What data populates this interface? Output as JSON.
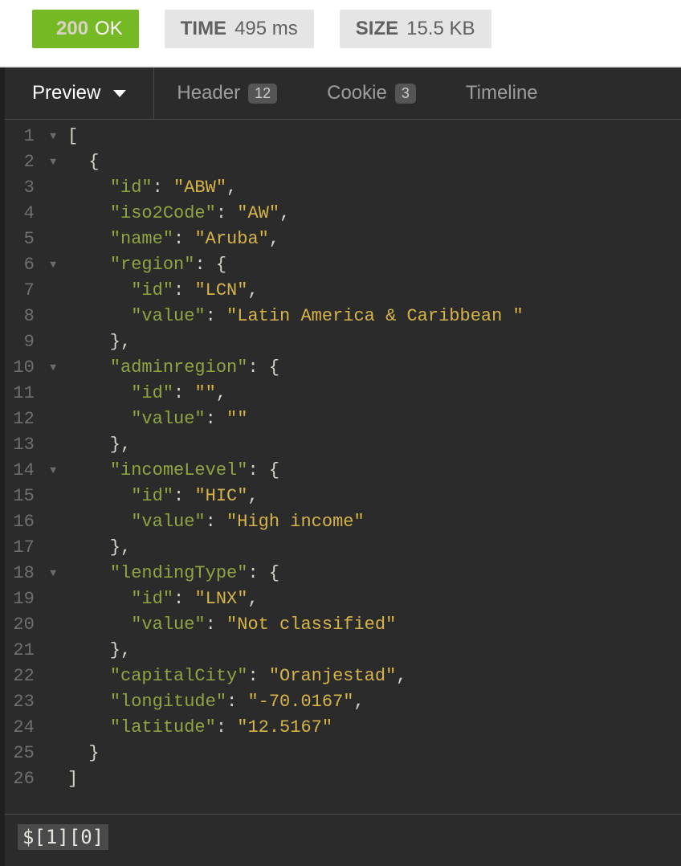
{
  "status": {
    "code": "200",
    "text": "OK"
  },
  "time": {
    "label": "TIME",
    "value": "495 ms"
  },
  "size": {
    "label": "SIZE",
    "value": "15.5 KB"
  },
  "tabs": {
    "preview": {
      "label": "Preview"
    },
    "header": {
      "label": "Header",
      "badge": "12"
    },
    "cookie": {
      "label": "Cookie",
      "badge": "3"
    },
    "timeline": {
      "label": "Timeline"
    }
  },
  "code_lines": [
    {
      "n": 1,
      "fold": true,
      "tokens": [
        [
          "punc",
          "["
        ]
      ]
    },
    {
      "n": 2,
      "fold": true,
      "tokens": [
        [
          "punc",
          "  {"
        ]
      ]
    },
    {
      "n": 3,
      "fold": false,
      "tokens": [
        [
          "punc",
          "    "
        ],
        [
          "key",
          "\"id\""
        ],
        [
          "punc",
          ": "
        ],
        [
          "str",
          "\"ABW\""
        ],
        [
          "punc",
          ","
        ]
      ]
    },
    {
      "n": 4,
      "fold": false,
      "tokens": [
        [
          "punc",
          "    "
        ],
        [
          "key",
          "\"iso2Code\""
        ],
        [
          "punc",
          ": "
        ],
        [
          "str",
          "\"AW\""
        ],
        [
          "punc",
          ","
        ]
      ]
    },
    {
      "n": 5,
      "fold": false,
      "tokens": [
        [
          "punc",
          "    "
        ],
        [
          "key",
          "\"name\""
        ],
        [
          "punc",
          ": "
        ],
        [
          "str",
          "\"Aruba\""
        ],
        [
          "punc",
          ","
        ]
      ]
    },
    {
      "n": 6,
      "fold": true,
      "tokens": [
        [
          "punc",
          "    "
        ],
        [
          "key",
          "\"region\""
        ],
        [
          "punc",
          ": {"
        ]
      ]
    },
    {
      "n": 7,
      "fold": false,
      "tokens": [
        [
          "punc",
          "      "
        ],
        [
          "key",
          "\"id\""
        ],
        [
          "punc",
          ": "
        ],
        [
          "str",
          "\"LCN\""
        ],
        [
          "punc",
          ","
        ]
      ]
    },
    {
      "n": 8,
      "fold": false,
      "tokens": [
        [
          "punc",
          "      "
        ],
        [
          "key",
          "\"value\""
        ],
        [
          "punc",
          ": "
        ],
        [
          "str",
          "\"Latin America & Caribbean \""
        ]
      ]
    },
    {
      "n": 9,
      "fold": false,
      "tokens": [
        [
          "punc",
          "    },"
        ]
      ]
    },
    {
      "n": 10,
      "fold": true,
      "tokens": [
        [
          "punc",
          "    "
        ],
        [
          "key",
          "\"adminregion\""
        ],
        [
          "punc",
          ": {"
        ]
      ]
    },
    {
      "n": 11,
      "fold": false,
      "tokens": [
        [
          "punc",
          "      "
        ],
        [
          "key",
          "\"id\""
        ],
        [
          "punc",
          ": "
        ],
        [
          "str",
          "\"\""
        ],
        [
          "punc",
          ","
        ]
      ]
    },
    {
      "n": 12,
      "fold": false,
      "tokens": [
        [
          "punc",
          "      "
        ],
        [
          "key",
          "\"value\""
        ],
        [
          "punc",
          ": "
        ],
        [
          "str",
          "\"\""
        ]
      ]
    },
    {
      "n": 13,
      "fold": false,
      "tokens": [
        [
          "punc",
          "    },"
        ]
      ]
    },
    {
      "n": 14,
      "fold": true,
      "tokens": [
        [
          "punc",
          "    "
        ],
        [
          "key",
          "\"incomeLevel\""
        ],
        [
          "punc",
          ": {"
        ]
      ]
    },
    {
      "n": 15,
      "fold": false,
      "tokens": [
        [
          "punc",
          "      "
        ],
        [
          "key",
          "\"id\""
        ],
        [
          "punc",
          ": "
        ],
        [
          "str",
          "\"HIC\""
        ],
        [
          "punc",
          ","
        ]
      ]
    },
    {
      "n": 16,
      "fold": false,
      "tokens": [
        [
          "punc",
          "      "
        ],
        [
          "key",
          "\"value\""
        ],
        [
          "punc",
          ": "
        ],
        [
          "str",
          "\"High income\""
        ]
      ]
    },
    {
      "n": 17,
      "fold": false,
      "tokens": [
        [
          "punc",
          "    },"
        ]
      ]
    },
    {
      "n": 18,
      "fold": true,
      "tokens": [
        [
          "punc",
          "    "
        ],
        [
          "key",
          "\"lendingType\""
        ],
        [
          "punc",
          ": {"
        ]
      ]
    },
    {
      "n": 19,
      "fold": false,
      "tokens": [
        [
          "punc",
          "      "
        ],
        [
          "key",
          "\"id\""
        ],
        [
          "punc",
          ": "
        ],
        [
          "str",
          "\"LNX\""
        ],
        [
          "punc",
          ","
        ]
      ]
    },
    {
      "n": 20,
      "fold": false,
      "tokens": [
        [
          "punc",
          "      "
        ],
        [
          "key",
          "\"value\""
        ],
        [
          "punc",
          ": "
        ],
        [
          "str",
          "\"Not classified\""
        ]
      ]
    },
    {
      "n": 21,
      "fold": false,
      "tokens": [
        [
          "punc",
          "    },"
        ]
      ]
    },
    {
      "n": 22,
      "fold": false,
      "tokens": [
        [
          "punc",
          "    "
        ],
        [
          "key",
          "\"capitalCity\""
        ],
        [
          "punc",
          ": "
        ],
        [
          "str",
          "\"Oranjestad\""
        ],
        [
          "punc",
          ","
        ]
      ]
    },
    {
      "n": 23,
      "fold": false,
      "tokens": [
        [
          "punc",
          "    "
        ],
        [
          "key",
          "\"longitude\""
        ],
        [
          "punc",
          ": "
        ],
        [
          "str",
          "\"-70.0167\""
        ],
        [
          "punc",
          ","
        ]
      ]
    },
    {
      "n": 24,
      "fold": false,
      "tokens": [
        [
          "punc",
          "    "
        ],
        [
          "key",
          "\"latitude\""
        ],
        [
          "punc",
          ": "
        ],
        [
          "str",
          "\"12.5167\""
        ]
      ]
    },
    {
      "n": 25,
      "fold": false,
      "tokens": [
        [
          "punc",
          "  }"
        ]
      ]
    },
    {
      "n": 26,
      "fold": false,
      "tokens": [
        [
          "punc",
          "]"
        ]
      ]
    }
  ],
  "json_path": "$[1][0]"
}
